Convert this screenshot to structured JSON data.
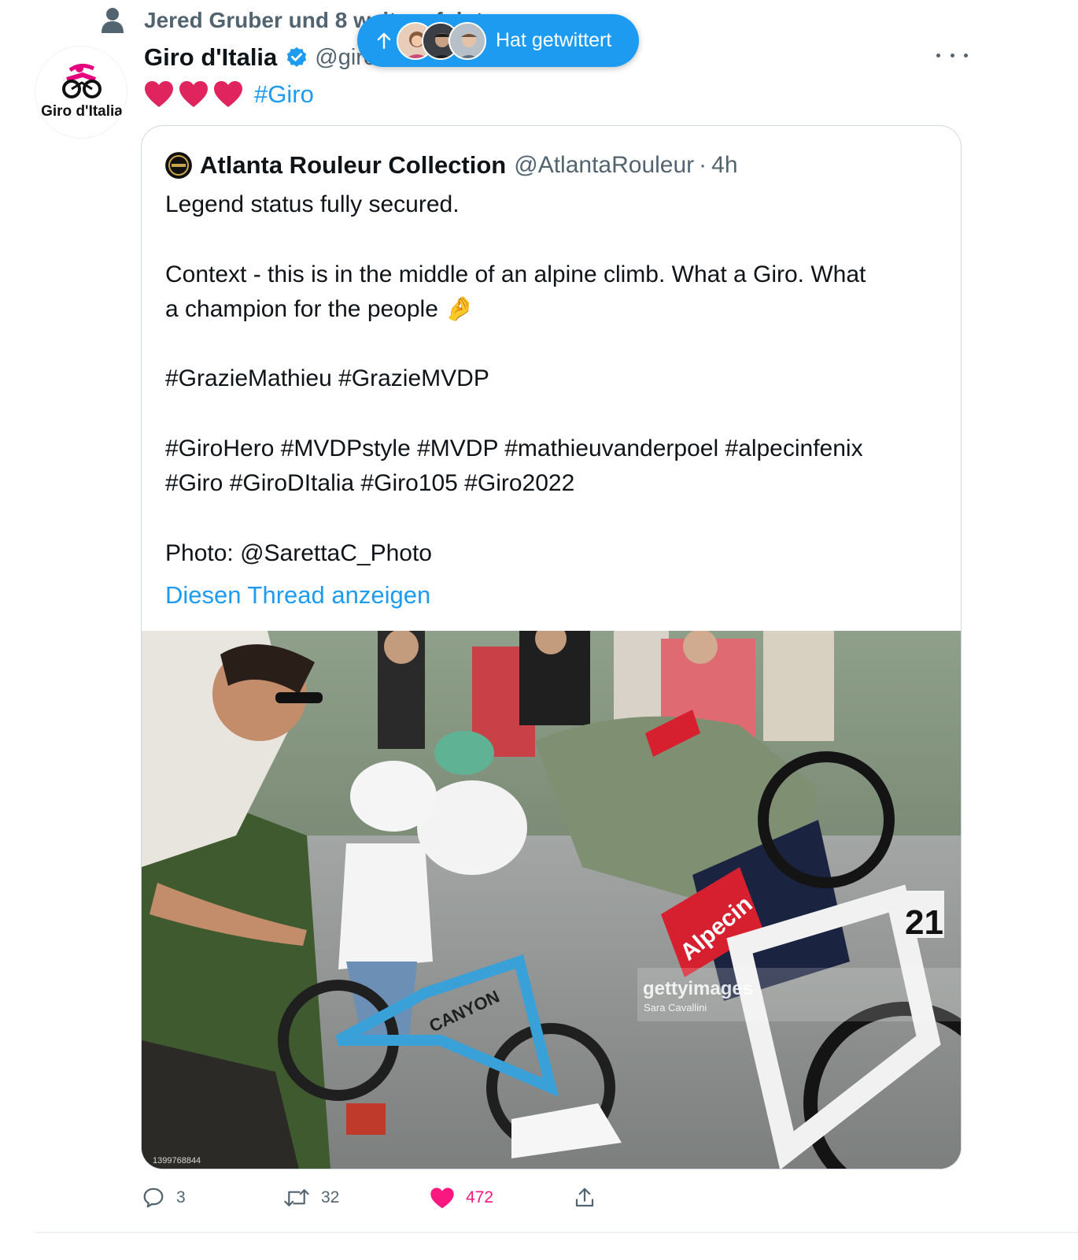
{
  "social_context": {
    "text": "Jered Gruber und 8 weitere folgt",
    "icon": "person-icon"
  },
  "tweet": {
    "author": {
      "name": "Giro d'Italia",
      "handle": "@giroditalia",
      "verified": true,
      "avatar_text": "Giro d'Italia"
    },
    "text_emoji": [
      "❤️",
      "❤️",
      "❤️"
    ],
    "hashtag": "#Giro",
    "more_icon": "more-horizontal-icon"
  },
  "new_tweets_pill": {
    "label": "Hat getwittert",
    "icon": "arrow-up-icon",
    "color": "#1d9bf0"
  },
  "quote": {
    "author": {
      "name": "Atlanta Rouleur Collection",
      "handle": "@AtlantaRouleur",
      "separator": "·",
      "time": "4h"
    },
    "lines": [
      "Legend status fully secured.",
      "",
      "Context - this is in the middle of an alpine climb. What a Giro. What",
      "a champion for the people 🤌",
      "",
      "#GrazieMathieu #GrazieMVDP",
      "",
      "#GiroHero #MVDPstyle #MVDP #mathieuvanderpoel #alpecinfenix",
      "#Giro #GiroDItalia #Giro105 #Giro2022",
      "",
      "Photo: @SarettaC_Photo"
    ],
    "show_thread": "Diesen Thread anzeigen",
    "photo": {
      "watermark": "gettyimages",
      "credit": "Sara Cavallini",
      "image_id": "1399768844",
      "jersey_text": "Alpecin",
      "race_number": "21",
      "bike_text": "CANYON"
    }
  },
  "actions": {
    "reply": {
      "icon": "reply-icon",
      "count": "3"
    },
    "retweet": {
      "icon": "retweet-icon",
      "count": "32"
    },
    "like": {
      "icon": "heart-icon",
      "count": "472",
      "liked": true
    },
    "share": {
      "icon": "share-icon"
    }
  },
  "colors": {
    "accent": "#1d9bf0",
    "like": "#f91880",
    "secondary_text": "#536471",
    "brand_pink": "#e6007e"
  }
}
